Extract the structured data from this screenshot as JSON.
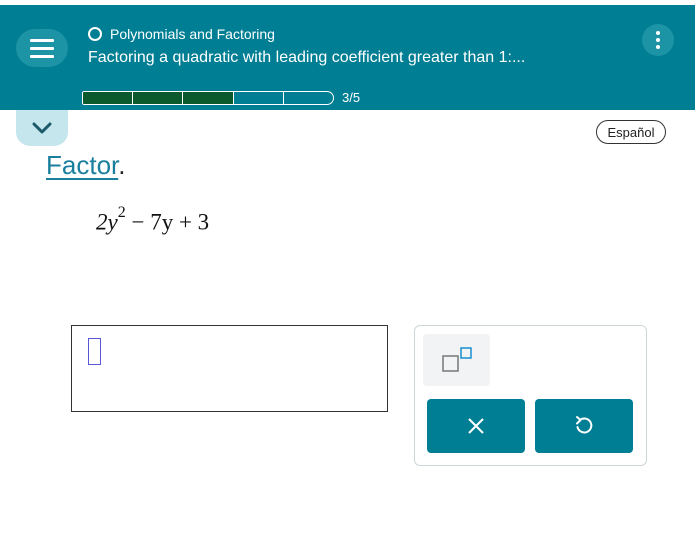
{
  "header": {
    "topic": "Polynomials and Factoring",
    "lesson_title": "Factoring a quadratic with leading coefficient greater than 1:...",
    "progress": {
      "current": 3,
      "total": 5,
      "label": "3/5"
    },
    "colors": {
      "header_bg": "#007e93",
      "progress_fill": "#0b5a2e"
    }
  },
  "language_button": "Español",
  "instruction": {
    "link_text": "Factor",
    "suffix": "."
  },
  "expression": {
    "coef": "2y",
    "exponent": "2",
    "rest": " − 7y + 3"
  },
  "keypad": {
    "keys": [
      {
        "name": "power-key",
        "icon": "square-superscript-icon"
      },
      {
        "name": "clear-key",
        "icon": "x-icon"
      },
      {
        "name": "undo-key",
        "icon": "undo-icon"
      }
    ]
  }
}
